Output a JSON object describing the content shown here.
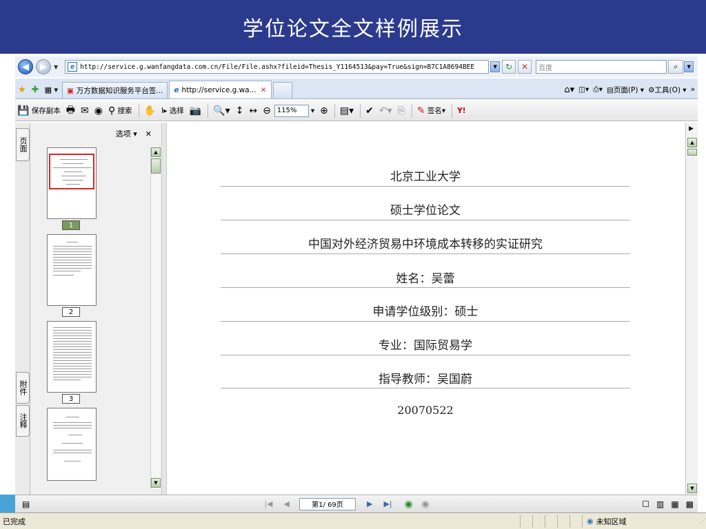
{
  "slide": {
    "title": "学位论文全文样例展示"
  },
  "address_bar": {
    "url": "http://service.g.wanfangdata.com.cn/File/File.ashx?fileid=Thesis_Y1164513&pay=True&sign=B7C1A8694BEE",
    "search_placeholder": "百度"
  },
  "tabs": [
    {
      "label": "万方数据知识服务平台签..."
    },
    {
      "label": "http://service.g.wa...",
      "close": "✕"
    }
  ],
  "ie_tools": {
    "page_label": "页面(P)",
    "tools_label": "工具(O)"
  },
  "pdf_toolbar": {
    "save_copy": "保存副本",
    "search": "搜索",
    "select": "选择",
    "zoom": "115%",
    "sign": "签名"
  },
  "sidebar": {
    "options": "选项",
    "close": "✕",
    "tabs": [
      "页面",
      "附件",
      "注释"
    ],
    "page_numbers": [
      "1",
      "2",
      "3"
    ]
  },
  "document": {
    "lines": [
      "北京工业大学",
      "硕士学位论文",
      "中国对外经济贸易中环境成本转移的实证研究",
      "姓名：吴蕾",
      "申请学位级别：硕士",
      "专业：国际贸易学",
      "指导教师：吴国蔚",
      "20070522"
    ]
  },
  "page_nav": {
    "page_indicator": "第1/ 69页"
  },
  "status": {
    "text": "已完成",
    "zone": "未知区域"
  }
}
